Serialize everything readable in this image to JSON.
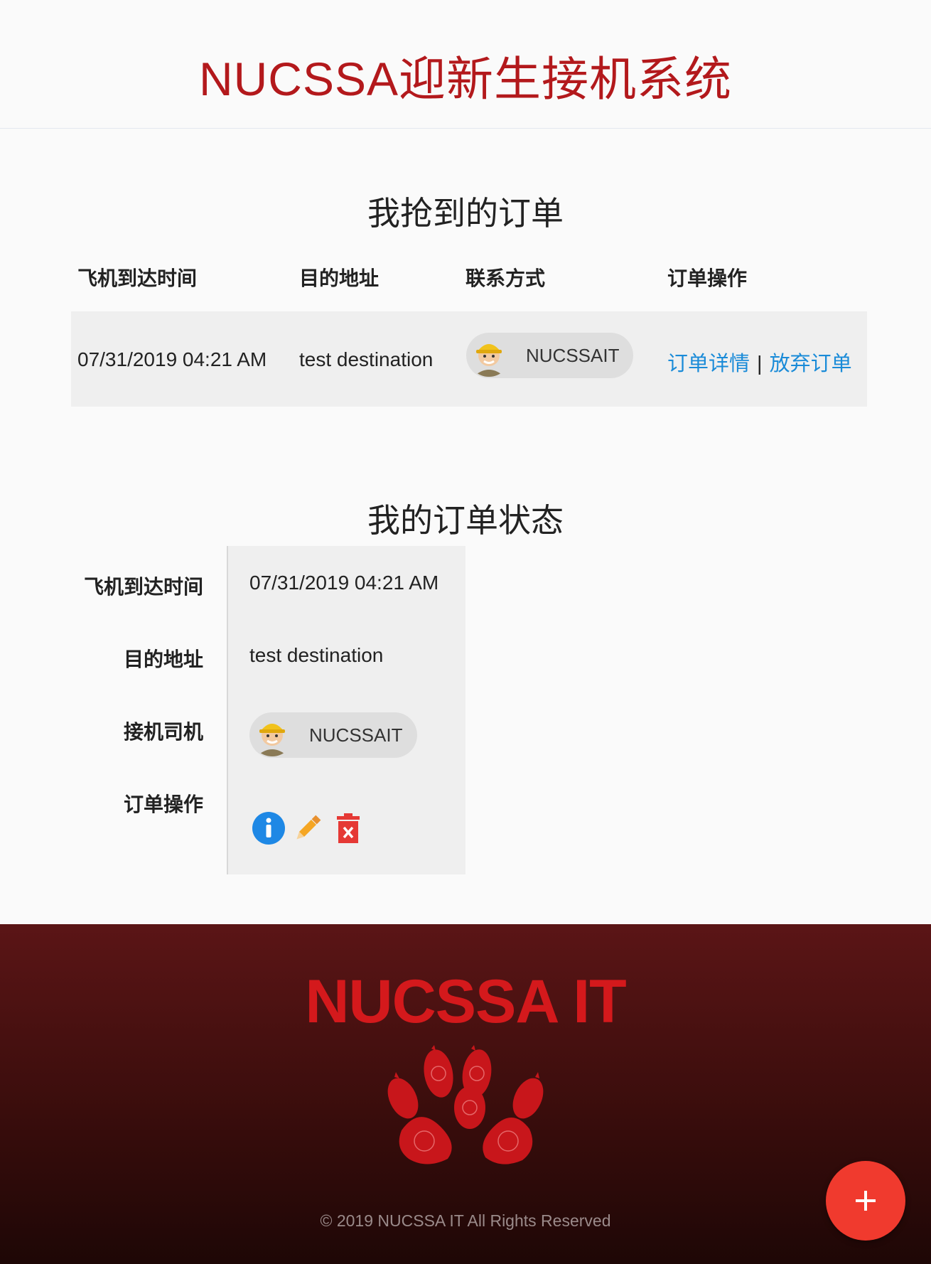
{
  "header": {
    "title": "NUCSSA迎新生接机系统"
  },
  "grabbed_orders": {
    "title": "我抢到的订单",
    "columns": [
      "飞机到达时间",
      "目的地址",
      "联系方式",
      "订单操作"
    ],
    "rows": [
      {
        "arrival_time": "07/31/2019 04:21 AM",
        "destination": "test destination",
        "contact_name": "NUCSSAIT",
        "detail_link": "订单详情",
        "separator": "|",
        "abandon_link": "放弃订单"
      }
    ]
  },
  "my_order_status": {
    "title": "我的订单状态",
    "labels": {
      "arrival_time": "飞机到达时间",
      "destination": "目的地址",
      "driver": "接机司机",
      "actions": "订单操作"
    },
    "values": {
      "arrival_time": "07/31/2019 04:21 AM",
      "destination": "test destination",
      "driver_name": "NUCSSAIT"
    },
    "action_icons": [
      "info-icon",
      "pencil-icon",
      "trash-icon"
    ]
  },
  "footer": {
    "brand": "NUCSSA IT",
    "logo_icon": "paw-logo-icon",
    "copyright": "© 2019 NUCSSA IT All Rights Reserved"
  },
  "fab": {
    "icon": "plus-icon"
  },
  "colors": {
    "title_red": "#b3191c",
    "link_blue": "#1a8bd8",
    "fab_red": "#f03a2e",
    "footer_dark": "#3a0d0c",
    "brand_red": "#d4191c"
  }
}
